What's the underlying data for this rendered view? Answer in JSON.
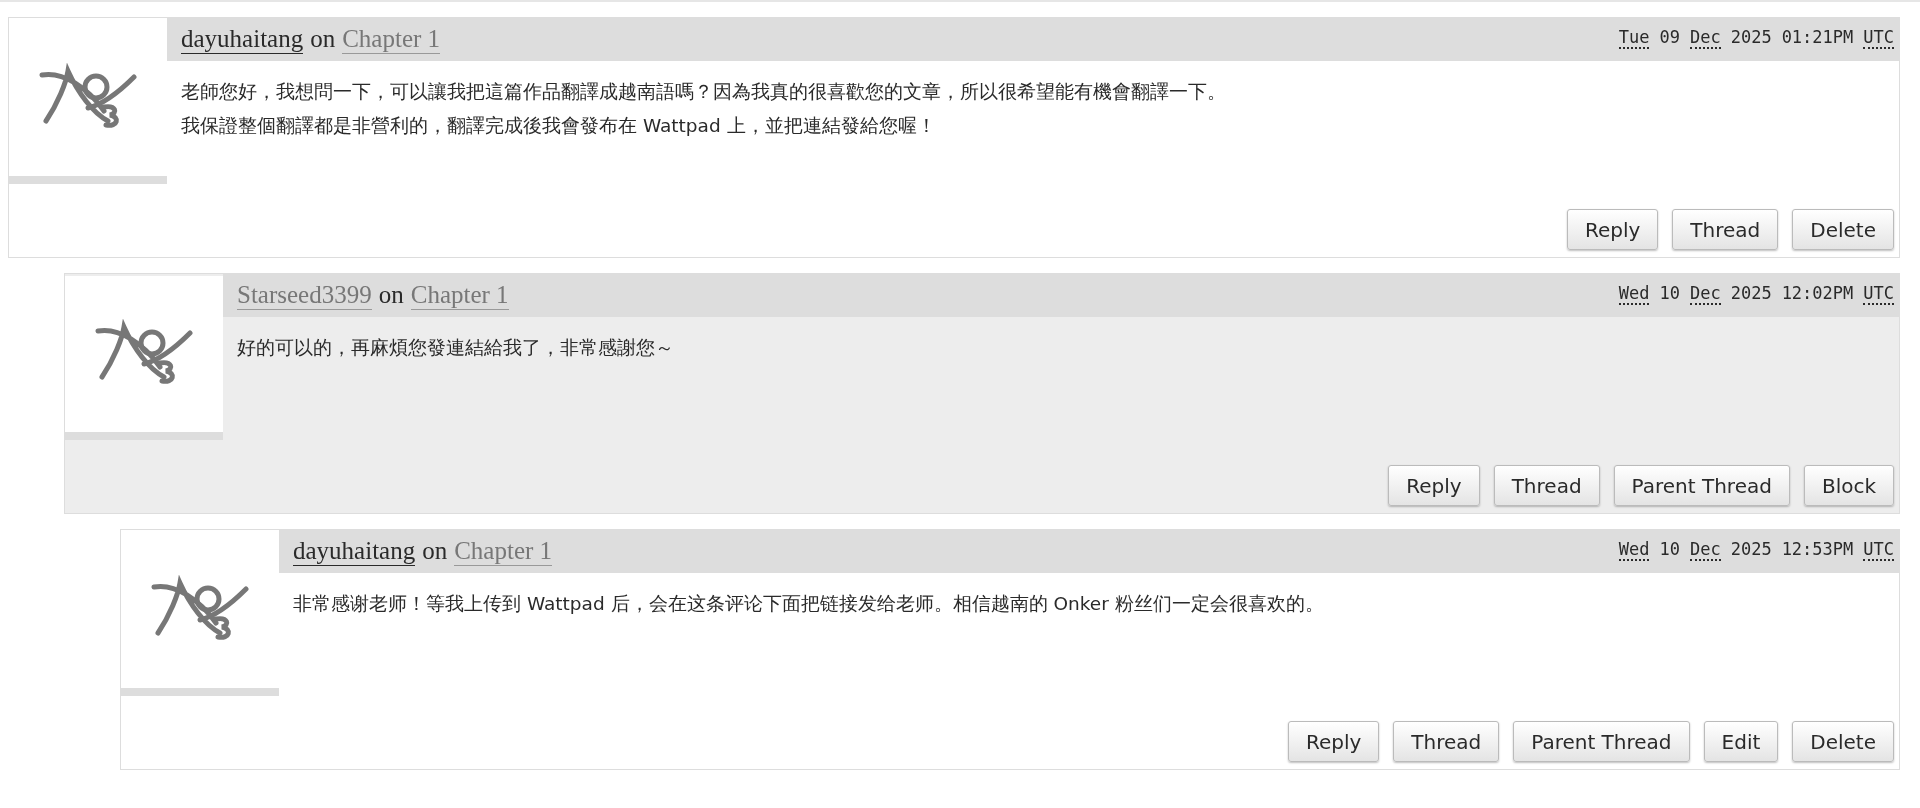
{
  "comments": [
    {
      "author": "dayuhaitang",
      "author_highlighted": true,
      "on": "on",
      "chapter": "Chapter 1",
      "shaded": false,
      "date": {
        "weekday": "Tue",
        "day": "09",
        "month": "Dec",
        "year": "2025",
        "time": "01:21PM",
        "zone": "UTC"
      },
      "lines": [
        "老師您好，我想問一下，可以讓我把這篇作品翻譯成越南語嗎？因為我真的很喜歡您的文章，所以很希望能有機會翻譯一下。",
        "我保證整個翻譯都是非營利的，翻譯完成後我會發布在 Wattpad 上，並把連結發給您喔！"
      ],
      "actions": [
        "Reply",
        "Thread",
        "Delete"
      ],
      "replies": [
        {
          "author": "Starseed3399",
          "author_highlighted": false,
          "on": "on",
          "chapter": "Chapter 1",
          "shaded": true,
          "date": {
            "weekday": "Wed",
            "day": "10",
            "month": "Dec",
            "year": "2025",
            "time": "12:02PM",
            "zone": "UTC"
          },
          "lines": [
            "好的可以的，再麻煩您發連結給我了，非常感謝您～"
          ],
          "actions": [
            "Reply",
            "Thread",
            "Parent Thread",
            "Block"
          ],
          "replies": [
            {
              "author": "dayuhaitang",
              "author_highlighted": true,
              "on": "on",
              "chapter": "Chapter 1",
              "shaded": false,
              "date": {
                "weekday": "Wed",
                "day": "10",
                "month": "Dec",
                "year": "2025",
                "time": "12:53PM",
                "zone": "UTC"
              },
              "lines": [
                "非常感谢老师！等我上传到 Wattpad 后，会在这条评论下面把链接发给老师。相信越南的 Onker 粉丝们一定会很喜欢的。"
              ],
              "actions": [
                "Reply",
                "Thread",
                "Parent Thread",
                "Edit",
                "Delete"
              ]
            }
          ]
        }
      ]
    }
  ]
}
